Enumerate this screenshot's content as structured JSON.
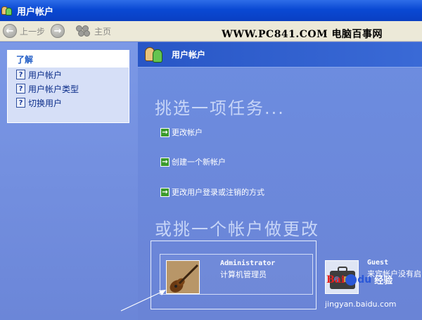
{
  "window": {
    "title": "用户帐户"
  },
  "toolbar": {
    "back_label": "上一步",
    "home_label": "主页",
    "watermark": "WWW.PC841.COM 电脑百事网"
  },
  "sidebar": {
    "header": "了解",
    "items": [
      {
        "label": "用户帐户",
        "icon": "help-icon"
      },
      {
        "label": "用户帐户类型",
        "icon": "help-icon"
      },
      {
        "label": "切换用户",
        "icon": "help-icon"
      }
    ]
  },
  "main": {
    "header_title": "用户帐户",
    "task_heading": "挑选一项任务...",
    "tasks": [
      {
        "label": "更改帐户"
      },
      {
        "label": "创建一个新帐户"
      },
      {
        "label": "更改用户登录或注销的方式"
      }
    ],
    "pick_heading": "或挑一个帐户做更改",
    "accounts": [
      {
        "name": "Administrator",
        "role": "计算机管理员",
        "picture": "guitar-picture"
      },
      {
        "name": "Guest",
        "role": "来宾帐户没有启",
        "picture": "suitcase-picture"
      }
    ]
  },
  "baidu": {
    "logo_b1": "Bai",
    "logo_b2": "du",
    "logo_label": "经验",
    "url": "jingyan.baidu.com"
  },
  "colors": {
    "title_bar": "#0a49d3",
    "main_bg": "#6b86d8",
    "heading": "#c7d5f7",
    "link_arrow": "#3c9a2c"
  }
}
